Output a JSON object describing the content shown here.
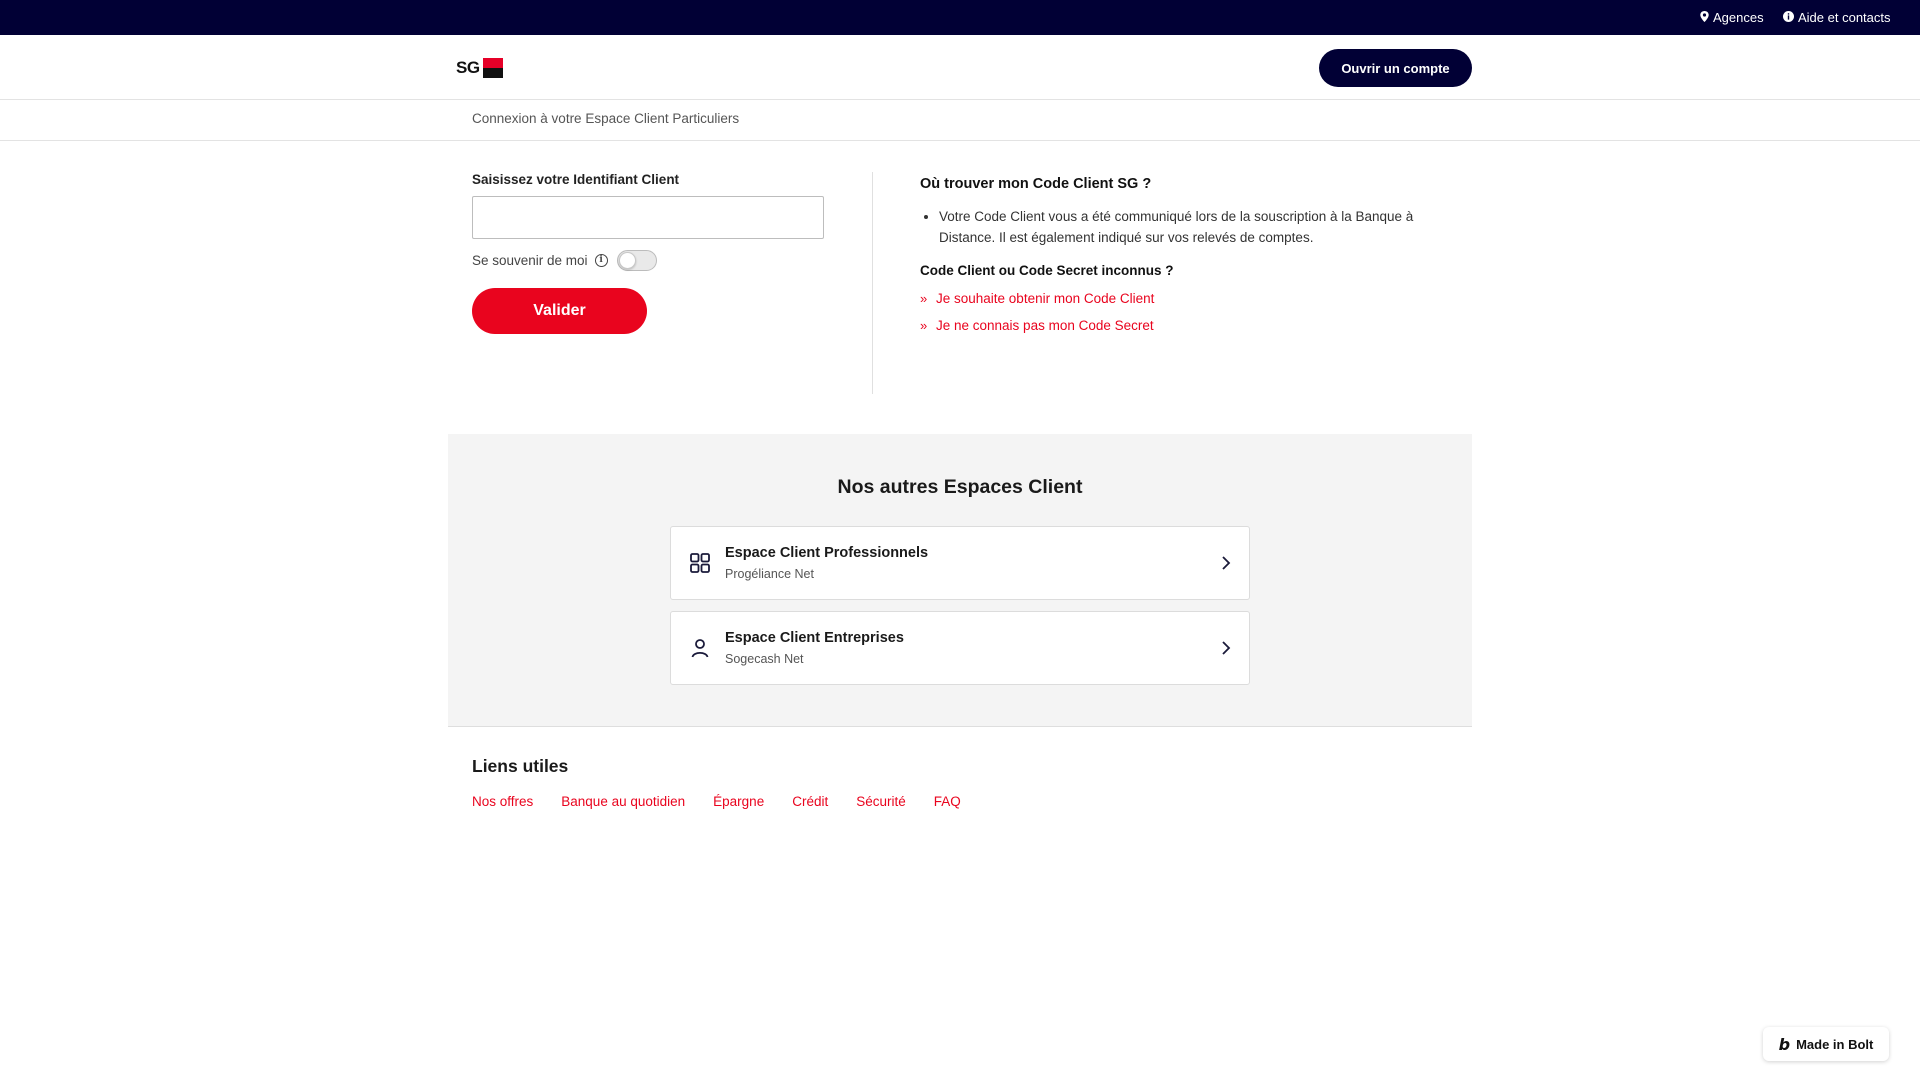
{
  "topbar": {
    "agencies_label": "Agences",
    "help_label": "Aide et contacts",
    "agencies_icon": "location-pin-icon",
    "help_icon": "help-icon"
  },
  "header": {
    "logo_text": "SG",
    "open_account_label": "Ouvrir un compte"
  },
  "breadcrumb": {
    "text": "Connexion à votre Espace Client Particuliers"
  },
  "login": {
    "id_label": "Saisissez votre Identifiant Client",
    "id_value": "",
    "remember_label": "Se souvenir de moi",
    "remember_on": false,
    "validate_label": "Valider"
  },
  "help": {
    "title": "Où trouver mon Code Client SG ?",
    "bullet": "Votre Code Client vous a été communiqué lors de la souscription à la Banque à Distance. Il est également indiqué sur vos relevés de comptes.",
    "subtitle": "Code Client ou Code Secret inconnus ?",
    "links": [
      {
        "label": "Je souhaite obtenir mon Code Client"
      },
      {
        "label": "Je ne connais pas mon Code Secret"
      }
    ]
  },
  "other_spaces": {
    "title": "Nos autres Espaces Client",
    "cards": [
      {
        "title": "Espace Client Professionnels",
        "subtitle": "Progéliance Net",
        "icon": "grid-icon"
      },
      {
        "title": "Espace Client Entreprises",
        "subtitle": "Sogecash Net",
        "icon": "user-icon"
      }
    ]
  },
  "useful": {
    "title": "Liens utiles",
    "links": [
      {
        "label": "Nos offres"
      },
      {
        "label": "Banque au quotidien"
      },
      {
        "label": "Épargne"
      },
      {
        "label": "Crédit"
      },
      {
        "label": "Sécurité"
      },
      {
        "label": "FAQ"
      }
    ]
  },
  "badge": {
    "label": "Made in Bolt"
  },
  "colors": {
    "navy": "#010035",
    "red": "#e9041e",
    "logo_red": "#e60028"
  }
}
